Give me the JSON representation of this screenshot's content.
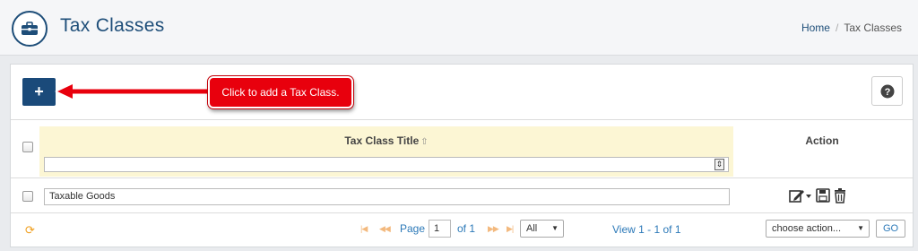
{
  "header": {
    "title": "Tax Classes",
    "breadcrumb": {
      "home": "Home",
      "separator": "/",
      "current": "Tax Classes"
    }
  },
  "toolbar": {
    "add_label": "+",
    "callout_text": "Click to add a Tax Class.",
    "help_label": "?"
  },
  "table": {
    "columns": {
      "title": "Tax Class Title",
      "action": "Action"
    },
    "filter_value": "",
    "rows": [
      {
        "title": "Taxable Goods"
      }
    ]
  },
  "pager": {
    "first": "|◀",
    "prev": "◀◀",
    "page_label": "Page",
    "page_value": "1",
    "of_label": "of 1",
    "next": "▶▶",
    "last": "▶|",
    "page_size": "All",
    "view_text": "View 1 - 1 of 1",
    "bulk_action": "choose action...",
    "go_label": "GO"
  },
  "colors": {
    "brand": "#1e4e79",
    "callout": "#e8000d",
    "filter_header": "#fcf6d4",
    "link": "#2c79b8"
  }
}
